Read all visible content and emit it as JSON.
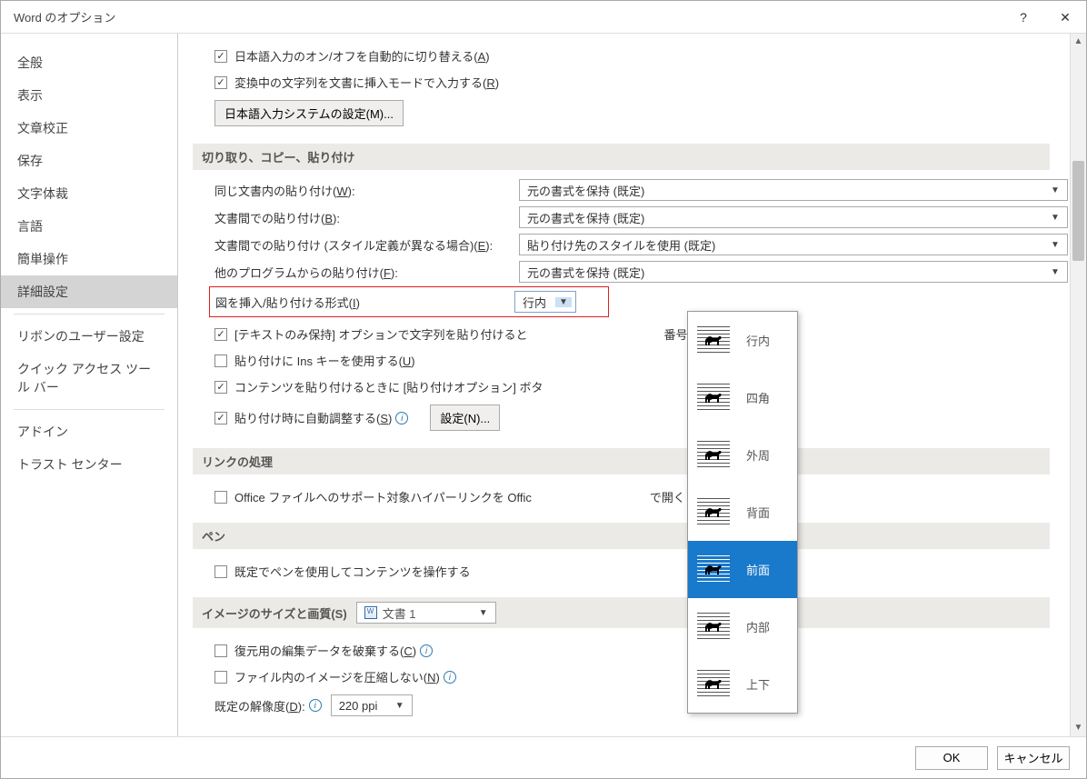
{
  "title": "Word のオプション",
  "sidebar": [
    {
      "label": "全般"
    },
    {
      "label": "表示"
    },
    {
      "label": "文章校正"
    },
    {
      "label": "保存"
    },
    {
      "label": "文字体裁"
    },
    {
      "label": "言語"
    },
    {
      "label": "簡単操作"
    },
    {
      "label": "詳細設定",
      "active": true
    },
    {
      "label": "リボンのユーザー設定",
      "sepBefore": true
    },
    {
      "label": "クイック アクセス ツール バー"
    },
    {
      "label": "アドイン",
      "sepBefore": true
    },
    {
      "label": "トラスト センター"
    }
  ],
  "top_checks": [
    {
      "label": "日本語入力のオン/オフを自動的に切り替える(",
      "accel": "A",
      "checked": true
    },
    {
      "label": "変換中の文字列を文書に挿入モードで入力する(",
      "accel": "R",
      "checked": true
    }
  ],
  "ime_button": "日本語入力システムの設定(M)...",
  "sections": {
    "cut_copy": "切り取り、コピー、貼り付け",
    "link": "リンクの処理",
    "pen": "ペン",
    "image": "イメージのサイズと画質(S)"
  },
  "paste_labels": {
    "same": "同じ文書内の貼り付け(",
    "same_a": "W",
    "between": "文書間での貼り付け(",
    "between_a": "B",
    "between_style": "文書間での貼り付け (スタイル定義が異なる場合)(",
    "between_style_a": "E",
    "other_prog": "他のプログラムからの貼り付け(",
    "other_prog_a": "F",
    "insert_img": "図を挿入/貼り付ける形式(",
    "insert_img_a": "I"
  },
  "paste_vals": {
    "keep_format": "元の書式を保持 (既定)",
    "use_dest": "貼り付け先のスタイルを使用 (既定)",
    "inline": "行内"
  },
  "sub_checks": {
    "textonly": "[テキストのみ保持] オプションで文字列を貼り付けると",
    "textonly_tail": "番号を保持する(L)",
    "ins": "貼り付けに Ins キーを使用する(",
    "ins_a": "U",
    "content_opt": "コンテンツを貼り付けるときに [貼り付けオプション] ボタ",
    "autoadj": "貼り付け時に自動調整する(",
    "autoadj_a": "S"
  },
  "settings_btn": "設定(N)...",
  "link_check": "Office ファイルへのサポート対象ハイパーリンクを Offic",
  "link_tail": "で開く",
  "pen_check": "既定でペンを使用してコンテンツを操作する",
  "image_combo_doc": "文書 1",
  "image_checks": {
    "discard": "復元用の編集データを破棄する(",
    "discard_a": "C",
    "nocompress": "ファイル内のイメージを圧縮しない(",
    "nocompress_a": "N"
  },
  "default_res_label": "既定の解像度(",
  "default_res_a": "D",
  "default_res_val": "220 ppi",
  "dropdown": [
    "行内",
    "四角",
    "外周",
    "背面",
    "前面",
    "内部",
    "上下"
  ],
  "footer": {
    "ok": "OK",
    "cancel": "キャンセル"
  }
}
